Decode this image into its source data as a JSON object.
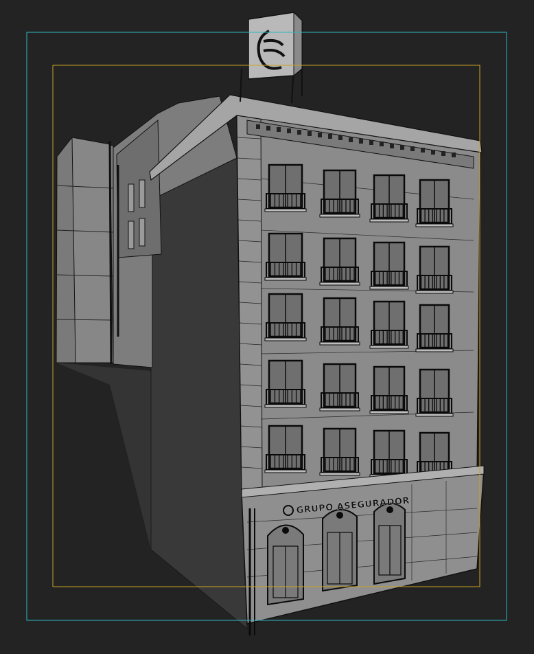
{
  "viewport": {
    "background": "#232323",
    "safe_frame_color": "#2fb8c4",
    "render_region_color": "#c9a227",
    "wire_color": "#0a0a0a",
    "facade_color": "#8a8a8a",
    "side_color": "#6c6c6c",
    "shadow_color": "#363636"
  },
  "building": {
    "sign_text": "GRUPO ASEGURADOR",
    "rooftop_logo": "insurance-logo"
  }
}
